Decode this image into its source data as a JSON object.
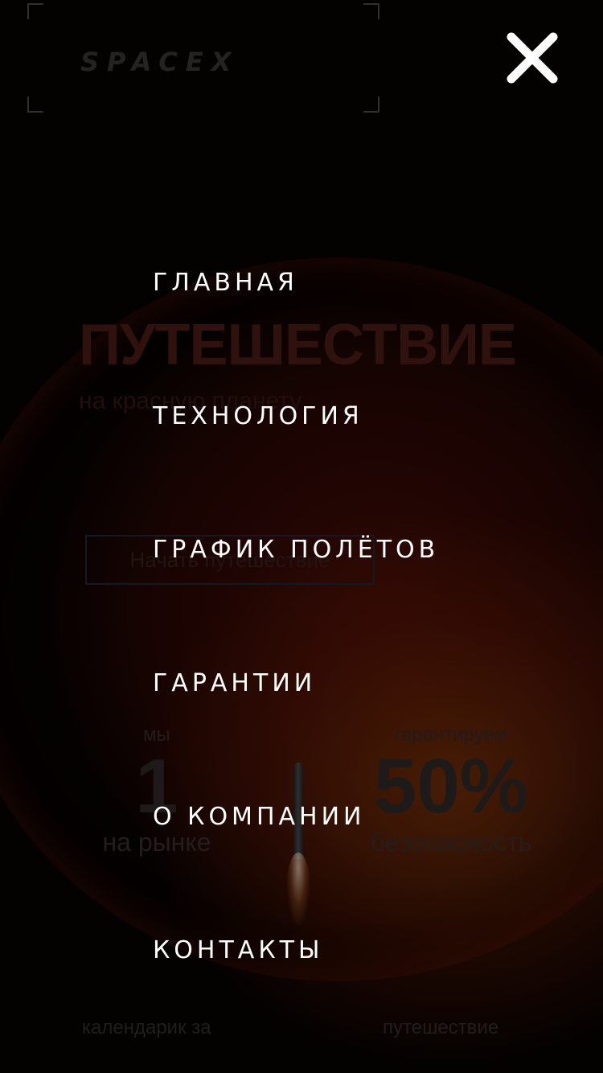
{
  "background": {
    "logo_text": "SPACEX",
    "title": "ПУТЕШЕСТВИЕ",
    "subtitle": "на красную планету",
    "cta_label": "Начать путешествие",
    "stats": [
      {
        "top": "мы",
        "number": "1",
        "bottom": "на рынке"
      },
      {
        "top": "гарантируем",
        "number": "50%",
        "bottom": "безопасность"
      }
    ],
    "footer": [
      "календарик за",
      "путешествие"
    ]
  },
  "menu": {
    "close_icon": "close-icon",
    "items": [
      {
        "label": "ГЛАВНАЯ"
      },
      {
        "label": "ТЕХНОЛОГИЯ"
      },
      {
        "label": "ГРАФИК ПОЛЁТОВ"
      },
      {
        "label": "ГАРАНТИИ"
      },
      {
        "label": "О КОМПАНИИ"
      },
      {
        "label": "КОНТАКТЫ"
      }
    ]
  },
  "colors": {
    "menu_text": "#ffffff",
    "background": "#050202",
    "accent_red": "#3a1612"
  }
}
